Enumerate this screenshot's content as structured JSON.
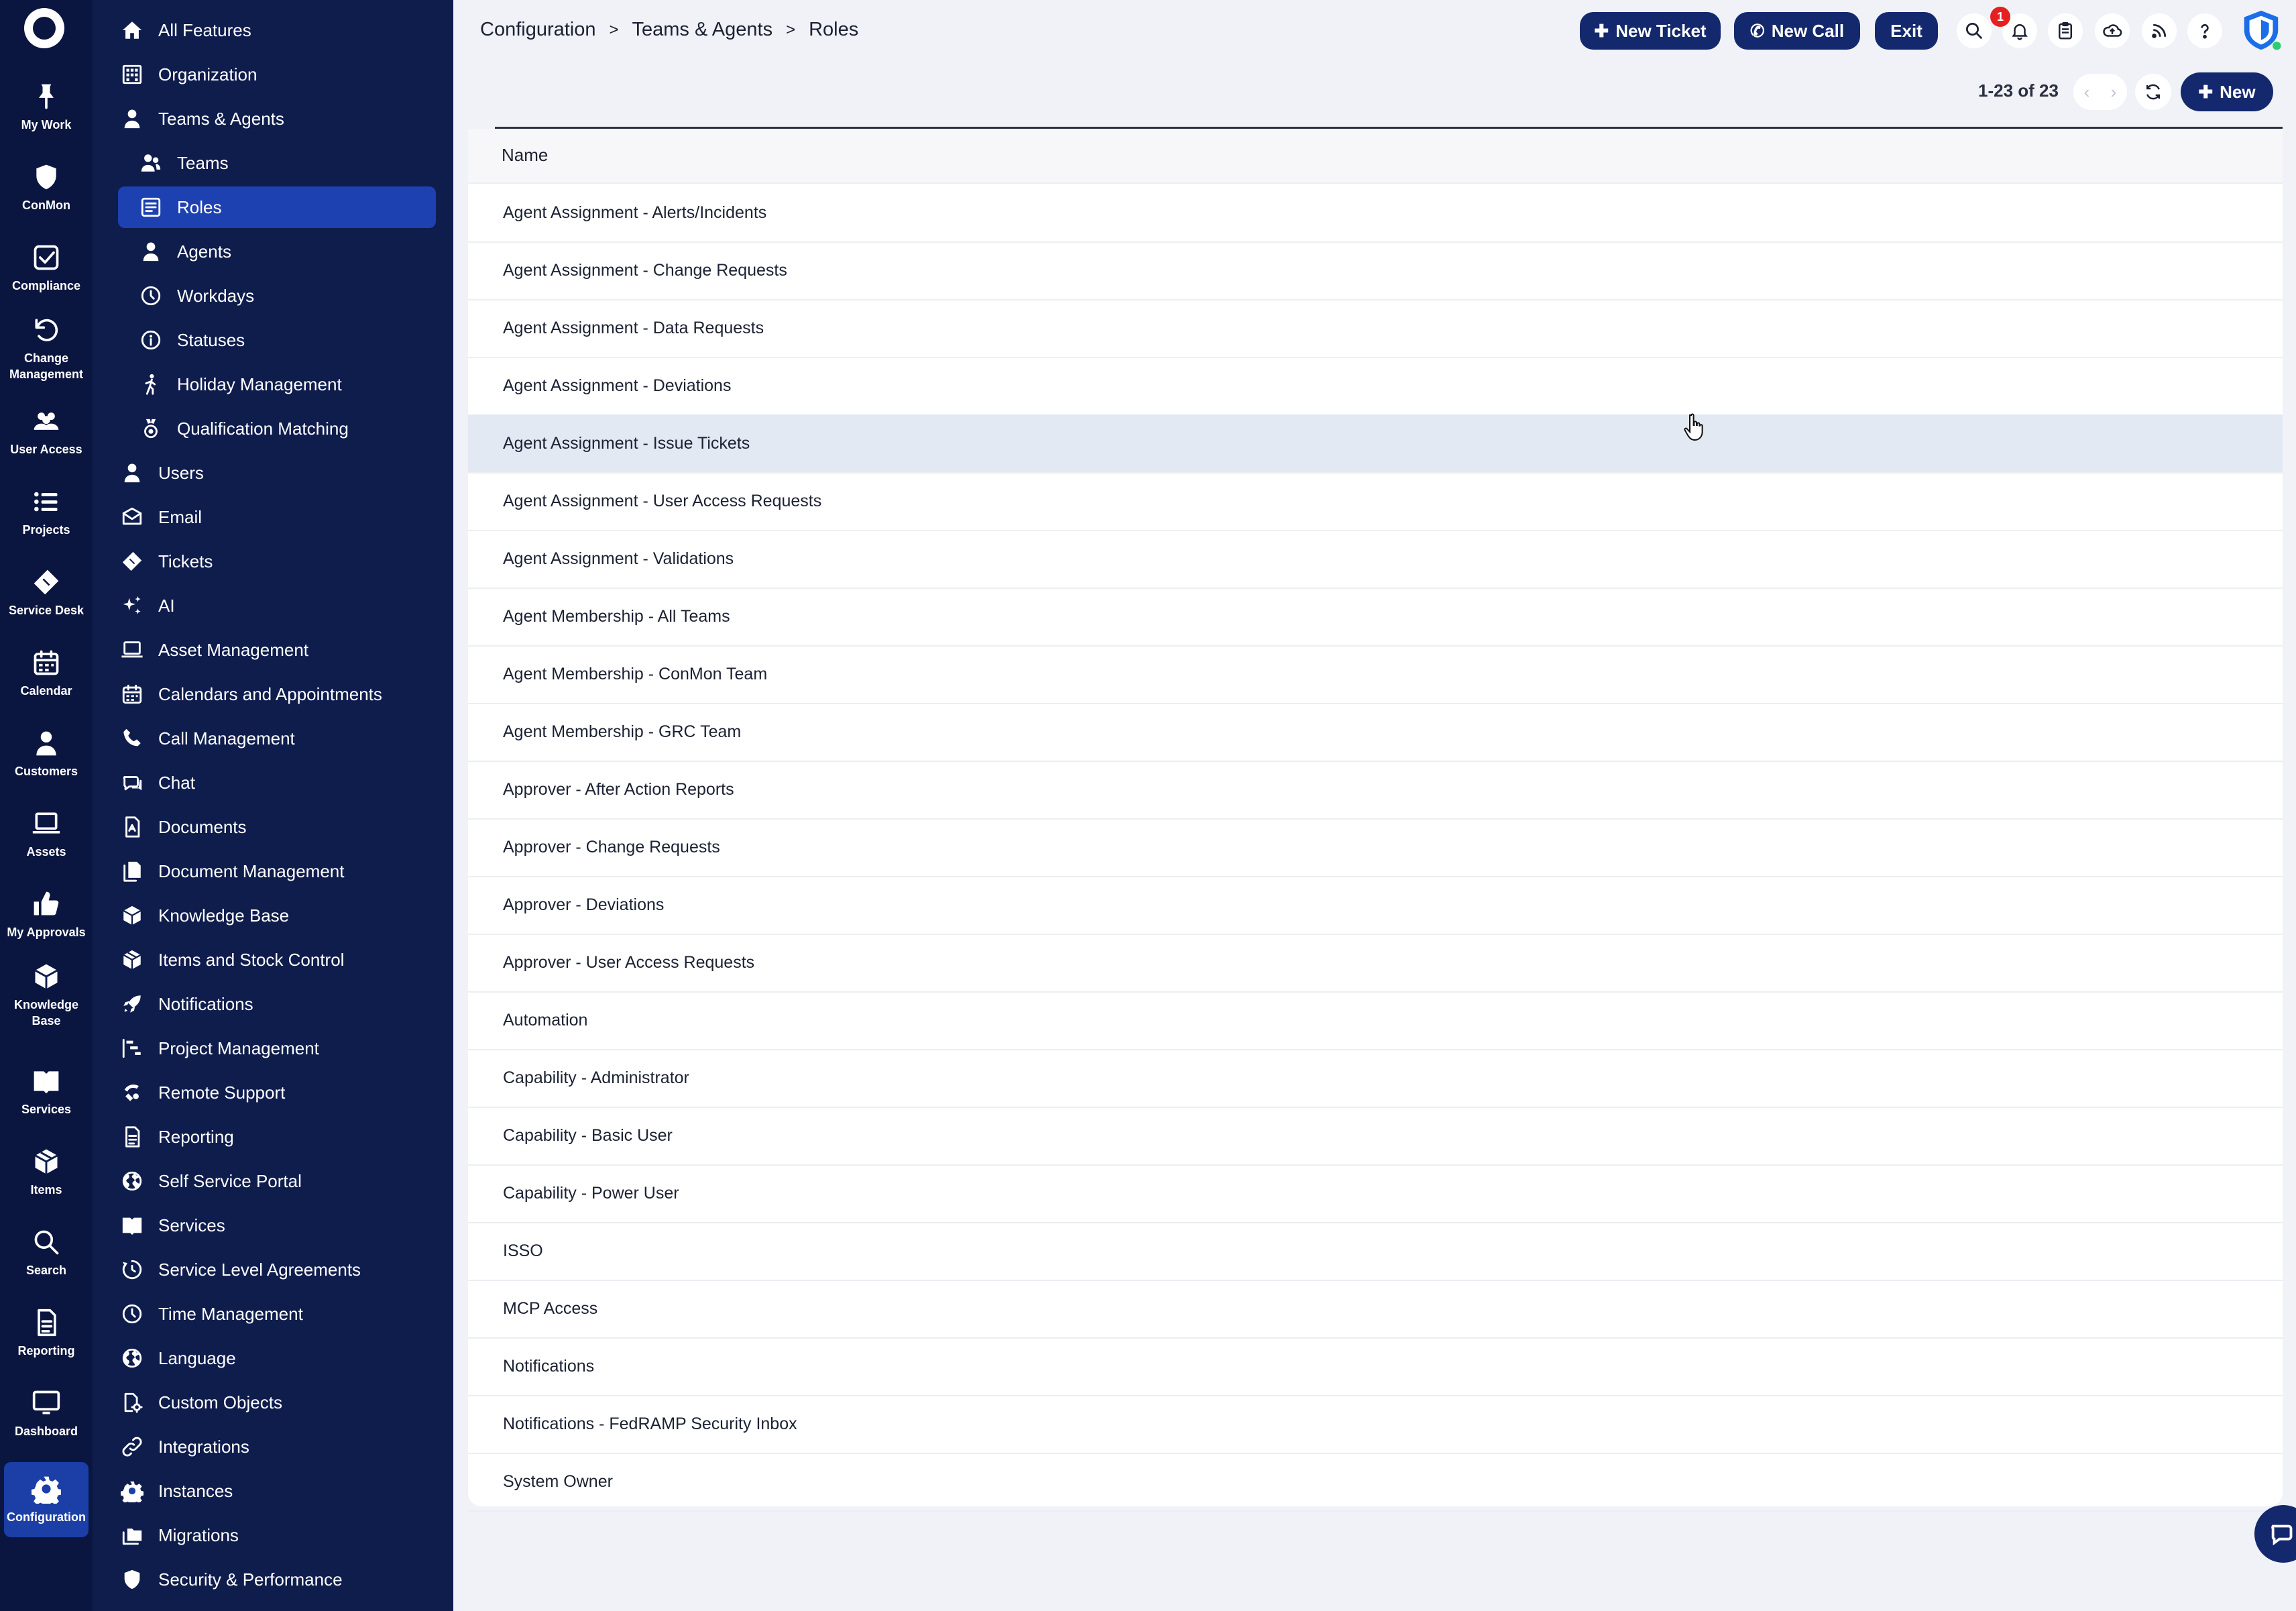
{
  "rail": {
    "items": [
      {
        "label": "My Work",
        "icon": "pin-icon"
      },
      {
        "label": "ConMon",
        "icon": "shield-icon"
      },
      {
        "label": "Compliance",
        "icon": "checkbox-icon"
      },
      {
        "label": "Change\nManagement",
        "icon": "undo-icon"
      },
      {
        "label": "User Access",
        "icon": "users-icon"
      },
      {
        "label": "Projects",
        "icon": "list-icon"
      },
      {
        "label": "Service Desk",
        "icon": "ticket-icon"
      },
      {
        "label": "Calendar",
        "icon": "calendar-icon"
      },
      {
        "label": "Customers",
        "icon": "person-icon"
      },
      {
        "label": "Assets",
        "icon": "laptop-icon"
      },
      {
        "label": "My Approvals",
        "icon": "thumbs-up-icon"
      },
      {
        "label": "Knowledge\nBase",
        "icon": "cube-icon"
      },
      {
        "label": "Services",
        "icon": "book-icon"
      },
      {
        "label": "Items",
        "icon": "box-icon"
      },
      {
        "label": "Search",
        "icon": "search-icon"
      },
      {
        "label": "Reporting",
        "icon": "report-icon"
      },
      {
        "label": "Dashboard",
        "icon": "monitor-icon"
      },
      {
        "label": "Configuration",
        "icon": "gear-icon"
      }
    ]
  },
  "menu": {
    "items": [
      {
        "label": "All Features",
        "icon": "home-icon",
        "level": 0
      },
      {
        "label": "Organization",
        "icon": "building-icon",
        "level": 0
      },
      {
        "label": "Teams & Agents",
        "icon": "person-icon",
        "level": 0
      },
      {
        "label": "Teams",
        "icon": "team-icon",
        "level": 1
      },
      {
        "label": "Roles",
        "icon": "roles-icon",
        "level": 1
      },
      {
        "label": "Agents",
        "icon": "person-icon",
        "level": 1
      },
      {
        "label": "Workdays",
        "icon": "clock-icon",
        "level": 1
      },
      {
        "label": "Statuses",
        "icon": "info-icon",
        "level": 1
      },
      {
        "label": "Holiday Management",
        "icon": "walking-icon",
        "level": 1
      },
      {
        "label": "Qualification Matching",
        "icon": "medal-icon",
        "level": 1
      },
      {
        "label": "Users",
        "icon": "person-icon",
        "level": 0
      },
      {
        "label": "Email",
        "icon": "email-icon",
        "level": 0
      },
      {
        "label": "Tickets",
        "icon": "ticket-icon",
        "level": 0
      },
      {
        "label": "AI",
        "icon": "sparkle-icon",
        "level": 0
      },
      {
        "label": "Asset Management",
        "icon": "laptop-icon",
        "level": 0
      },
      {
        "label": "Calendars and Appointments",
        "icon": "calendar-icon",
        "level": 0
      },
      {
        "label": "Call Management",
        "icon": "phone-icon",
        "level": 0
      },
      {
        "label": "Chat",
        "icon": "chat-icon",
        "level": 0
      },
      {
        "label": "Documents",
        "icon": "document-icon",
        "level": 0
      },
      {
        "label": "Document Management",
        "icon": "documents-icon",
        "level": 0
      },
      {
        "label": "Knowledge Base",
        "icon": "cube-icon",
        "level": 0
      },
      {
        "label": "Items and Stock Control",
        "icon": "box-icon",
        "level": 0
      },
      {
        "label": "Notifications",
        "icon": "rocket-icon",
        "level": 0
      },
      {
        "label": "Project Management",
        "icon": "gantt-icon",
        "level": 0
      },
      {
        "label": "Remote Support",
        "icon": "remote-icon",
        "level": 0
      },
      {
        "label": "Reporting",
        "icon": "report-icon",
        "level": 0
      },
      {
        "label": "Self Service Portal",
        "icon": "globe-icon",
        "level": 0
      },
      {
        "label": "Services",
        "icon": "book-icon",
        "level": 0
      },
      {
        "label": "Service Level Agreements",
        "icon": "timer-icon",
        "level": 0
      },
      {
        "label": "Time Management",
        "icon": "clock-icon",
        "level": 0
      },
      {
        "label": "Language",
        "icon": "globe-icon",
        "level": 0
      },
      {
        "label": "Custom Objects",
        "icon": "custom-object-icon",
        "level": 0
      },
      {
        "label": "Integrations",
        "icon": "link-icon",
        "level": 0
      },
      {
        "label": "Instances",
        "icon": "gear-icon",
        "level": 0
      },
      {
        "label": "Migrations",
        "icon": "folders-icon",
        "level": 0
      },
      {
        "label": "Security & Performance",
        "icon": "shield-icon",
        "level": 0
      }
    ]
  },
  "breadcrumb": {
    "items": [
      "Configuration",
      "Teams & Agents",
      "Roles"
    ],
    "separator": ">"
  },
  "header": {
    "new_ticket": "New Ticket",
    "new_call": "New Call",
    "exit": "Exit",
    "notification_count": "1",
    "tools": [
      "search-icon",
      "bell-icon",
      "clipboard-icon",
      "cloud-upload-icon",
      "rss-icon",
      "help-icon",
      "shield-logo-icon"
    ]
  },
  "list": {
    "count": "1-23 of 23",
    "new_label": "New",
    "column_header": "Name",
    "rows": [
      "Agent Assignment - Alerts/Incidents",
      "Agent Assignment - Change Requests",
      "Agent Assignment - Data Requests",
      "Agent Assignment - Deviations",
      "Agent Assignment - Issue Tickets",
      "Agent Assignment - User Access Requests",
      "Agent Assignment - Validations",
      "Agent Membership - All Teams",
      "Agent Membership - ConMon Team",
      "Agent Membership - GRC Team",
      "Approver - After Action Reports",
      "Approver - Change Requests",
      "Approver - Deviations",
      "Approver - User Access Requests",
      "Automation",
      "Capability - Administrator",
      "Capability - Basic User",
      "Capability - Power User",
      "ISSO",
      "MCP Access",
      "Notifications",
      "Notifications - FedRAMP Security Inbox",
      "System Owner"
    ],
    "hovered_row": 4
  },
  "colors": {
    "rail_bg": "#0b1640",
    "menu_bg": "#0f1d4d",
    "accent": "#1d41b0",
    "button": "#14286e",
    "row_hover": "#e2e9f3"
  }
}
